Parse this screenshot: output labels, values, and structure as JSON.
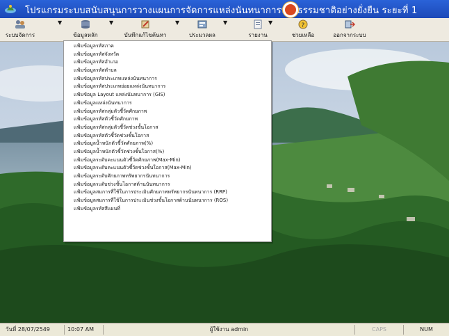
{
  "window": {
    "title": "โปรแกรมระบบสนับสนุนการวางแผนการจัดการแหล่งนันทนาการทางธรรมชาติอย่างยั่งยืน ระยะที่ 1"
  },
  "toolbar": {
    "items": [
      {
        "label": "ระบบจัดการ",
        "icon": "users-icon"
      },
      {
        "label": "ข้อมูลหลัก",
        "icon": "database-icon"
      },
      {
        "label": "บันทึกแก้ไขค้นหา",
        "icon": "edit-search-icon"
      },
      {
        "label": "ประมวลผล",
        "icon": "process-icon"
      },
      {
        "label": "รายงาน",
        "icon": "report-icon"
      },
      {
        "label": "ช่วยเหลือ",
        "icon": "help-icon"
      },
      {
        "label": "ออกจากระบบ",
        "icon": "exit-icon"
      }
    ]
  },
  "menu": {
    "items": [
      "แฟ้มข้อมูลรหัสภาค",
      "แฟ้มข้อมูลรหัสจังหวัด",
      "แฟ้มข้อมูลรหัสอำเภอ",
      "แฟ้มข้อมูลรหัสตำบล",
      "แฟ้มข้อมูลรหัสประเภทแหล่งนันทนาการ",
      "แฟ้มข้อมูลรหัสประเภทย่อยแหล่งนันทนาการ",
      "แฟ้มข้อมูล Layout แหล่งนันทนาการ (GIS)",
      "แฟ้มข้อมูลแหล่งนันทนาการ",
      "แฟ้มข้อมูลรหัสกลุ่มตัวชี้วัดศักยภาพ",
      "แฟ้มข้อมูลรหัสตัวชี้วัดศักยภาพ",
      "แฟ้มข้อมูลรหัสกลุ่มตัวชี้วัดช่วงชั้นโอกาส",
      "แฟ้มข้อมูลรหัสตัวชี้วัดช่วงชั้นโอกาส",
      "แฟ้มข้อมูลน้ำหนักตัวชี้วัดศักยภาพ(%)",
      "แฟ้มข้อมูลน้ำหนักตัวชี้วัดช่วงชั้นโอกาส(%)",
      "แฟ้มข้อมูลระดับคะแนนตัวชี้วัดศักยภาพ(Max-Min)",
      "แฟ้มข้อมูลระดับคะแนนตัวชี้วัดช่วงชั้นโอกาส(Max-Min)",
      "แฟ้มข้อมูลระดับศักยภาพทรัพยากรนันทนาการ",
      "แฟ้มข้อมูลระดับช่วงชั้นโอกาสด้านนันทนาการ",
      "แฟ้มข้อมูลสมการที่ใช้ในการประเมินศักยภาพทรัพยากรนันทนาการ (RRP)",
      "แฟ้มข้อมูลสมการที่ใช้ในการประเมินช่วงชั้นโอกาสด้านนันทนาการ (ROS)",
      "แฟ้มข้อมูลรหัสสีแผนที่"
    ]
  },
  "statusbar": {
    "date": "วันที่ 28/07/2549",
    "time": "10:07 AM",
    "user": "ผู้ใช้งาน admin",
    "caps": "CAPS",
    "num": "NUM"
  },
  "colors": {
    "titlebar": "#1c49b8",
    "toolbar_bg": "#eeeae0",
    "menu_bg": "#ffffff",
    "statusbar_bg": "#ece9d8"
  }
}
